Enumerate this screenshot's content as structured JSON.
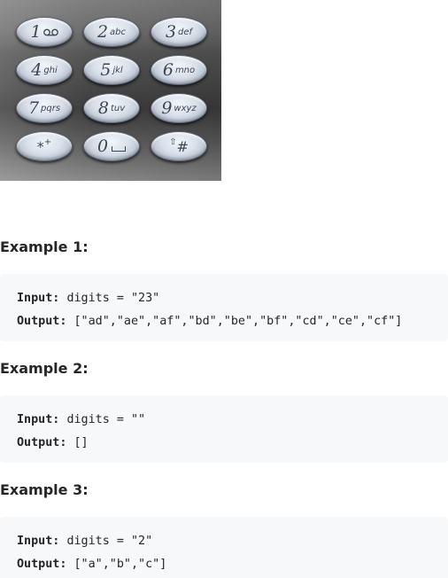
{
  "keypad": {
    "keys": [
      {
        "digit": "1",
        "letters": "",
        "icon": "voicemail-icon"
      },
      {
        "digit": "2",
        "letters": "abc"
      },
      {
        "digit": "3",
        "letters": "def"
      },
      {
        "digit": "4",
        "letters": "ghi"
      },
      {
        "digit": "5",
        "letters": "jkl"
      },
      {
        "digit": "6",
        "letters": "mno"
      },
      {
        "digit": "7",
        "letters": "pqrs"
      },
      {
        "digit": "8",
        "letters": "tuv"
      },
      {
        "digit": "9",
        "letters": "wxyz"
      },
      {
        "digit": "*",
        "letters": "+"
      },
      {
        "digit": "0",
        "letters": "",
        "icon": "space-icon"
      },
      {
        "digit": "#",
        "letters": "⇧"
      }
    ]
  },
  "examples": [
    {
      "heading": "Example 1:",
      "input_label": "Input:",
      "input_value": "digits = \"23\"",
      "output_label": "Output:",
      "output_value": "[\"ad\",\"ae\",\"af\",\"bd\",\"be\",\"bf\",\"cd\",\"ce\",\"cf\"]"
    },
    {
      "heading": "Example 2:",
      "input_label": "Input:",
      "input_value": "digits = \"\"",
      "output_label": "Output:",
      "output_value": "[]"
    },
    {
      "heading": "Example 3:",
      "input_label": "Input:",
      "input_value": "digits = \"2\"",
      "output_label": "Output:",
      "output_value": "[\"a\",\"b\",\"c\"]"
    }
  ]
}
